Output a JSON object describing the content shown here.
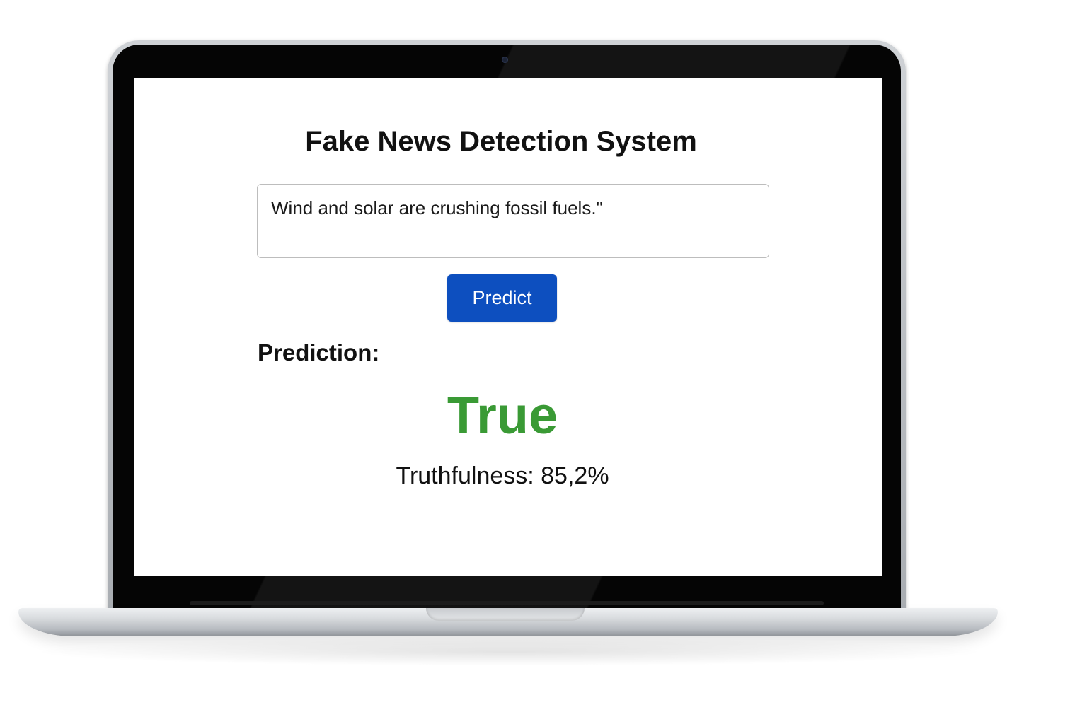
{
  "app": {
    "title": "Fake News Detection System"
  },
  "input": {
    "value": "Wind and solar are crushing fossil fuels.\"",
    "placeholder": ""
  },
  "actions": {
    "predict_label": "Predict"
  },
  "result": {
    "heading": "Prediction:",
    "label": "True",
    "label_color": "#3a9a35",
    "truthfulness_text": "Truthfulness: 85,2%",
    "truthfulness_percent": 85.2
  },
  "colors": {
    "primary_button": "#0d4fbf",
    "text": "#111111"
  },
  "icons": {
    "camera": "webcam-icon"
  }
}
